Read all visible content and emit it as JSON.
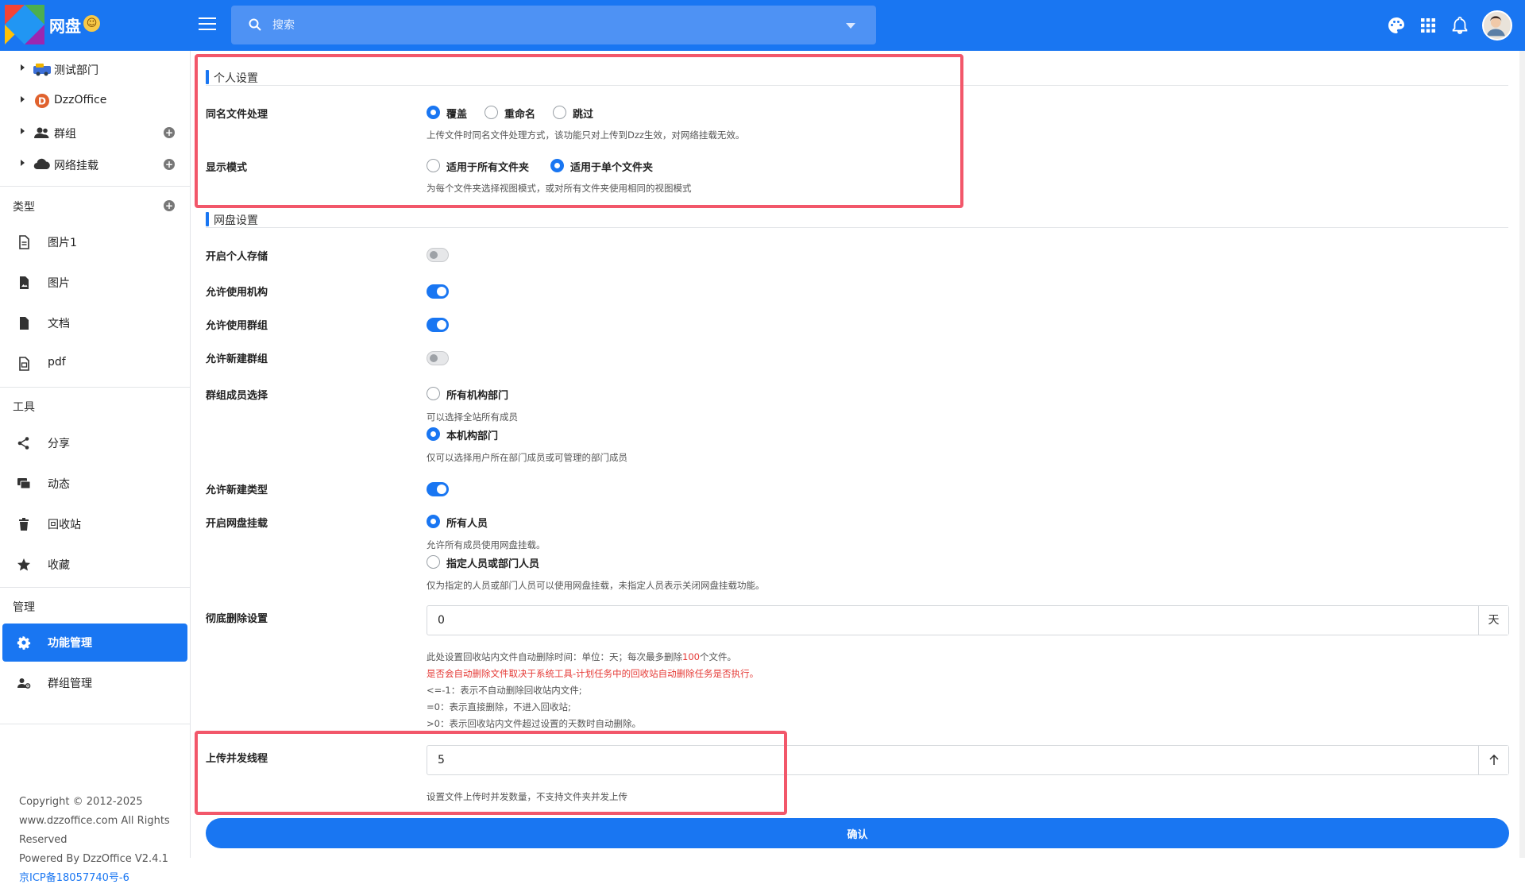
{
  "topbar": {
    "app_title": "网盘",
    "app_emoji": "😊",
    "search_placeholder": "搜索",
    "icons": [
      "palette-icon",
      "apps-grid-icon",
      "bell-icon"
    ],
    "brand_color": "#1976f2"
  },
  "sidebar": {
    "tree": [
      {
        "label": "测试部门",
        "icon": "department-icon",
        "has_add": false
      },
      {
        "label": "DzzOffice",
        "icon": "org-d-icon",
        "has_add": false
      },
      {
        "label": "群组",
        "icon": "group-icon",
        "has_add": true
      },
      {
        "label": "网络挂载",
        "icon": "cloud-icon",
        "has_add": true
      }
    ],
    "types_title": "类型",
    "types": [
      {
        "label": "图片1",
        "icon": "file-icon"
      },
      {
        "label": "图片",
        "icon": "image-file-icon"
      },
      {
        "label": "文档",
        "icon": "document-icon"
      },
      {
        "label": "pdf",
        "icon": "pdf-file-icon"
      }
    ],
    "tools_title": "工具",
    "tools": [
      {
        "label": "分享",
        "icon": "share-icon"
      },
      {
        "label": "动态",
        "icon": "activity-icon"
      },
      {
        "label": "回收站",
        "icon": "trash-icon"
      },
      {
        "label": "收藏",
        "icon": "star-icon"
      }
    ],
    "admin_title": "管理",
    "admin": [
      {
        "label": "功能管理",
        "icon": "gear-icon",
        "active": true
      },
      {
        "label": "群组管理",
        "icon": "group-manage-icon",
        "active": false
      }
    ],
    "footer": {
      "copyright": "Copyright © 2012-2025",
      "site": "www.dzzoffice.com All Rights",
      "reserved": "Reserved",
      "powered": "Powered By DzzOffice V2.4.1",
      "icp": "京ICP备18057740号-6"
    }
  },
  "personal": {
    "title": "个人设置",
    "same_name": {
      "label": "同名文件处理",
      "options": [
        "覆盖",
        "重命名",
        "跳过"
      ],
      "selected": 0,
      "hint": "上传文件时同名文件处理方式，该功能只对上传到Dzz生效，对网络挂载无效。"
    },
    "display_mode": {
      "label": "显示模式",
      "options": [
        "适用于所有文件夹",
        "适用于单个文件夹"
      ],
      "selected": 1,
      "hint": "为每个文件夹选择视图模式，或对所有文件夹使用相同的视图模式"
    }
  },
  "netdisk": {
    "title": "网盘设置",
    "personal_storage": {
      "label": "开启个人存储",
      "on": false
    },
    "allow_org": {
      "label": "允许使用机构",
      "on": true
    },
    "allow_group": {
      "label": "允许使用群组",
      "on": true
    },
    "allow_new_group": {
      "label": "允许新建群组",
      "on": false
    },
    "group_member": {
      "label": "群组成员选择",
      "opt1": "所有机构部门",
      "hint1": "可以选择全站所有成员",
      "opt2": "本机构部门",
      "hint2": "仅可以选择用户所在部门成员或可管理的部门成员",
      "selected": 1
    },
    "allow_new_type": {
      "label": "允许新建类型",
      "on": true
    },
    "mount": {
      "label": "开启网盘挂载",
      "opt1": "所有人员",
      "hint1": "允许所有成员使用网盘挂载。",
      "opt2": "指定人员或部门人员",
      "hint2": "仅为指定的人员或部门人员可以使用网盘挂载，未指定人员表示关闭网盘挂载功能。",
      "selected": 0
    },
    "purge": {
      "label": "彻底删除设置",
      "value": "0",
      "unit": "天",
      "hint_pre": "此处设置回收站内文件自动删除时间：单位：天；每次最多删除",
      "hint_num": "100",
      "hint_post": "个文件。",
      "hint_red": "是否会自动删除文件取决于系统工具-计划任务中的回收站自动删除任务是否执行。",
      "rule1": "<=-1：表示不自动删除回收站内文件;",
      "rule2": "=0：表示直接删除，不进入回收站;",
      "rule3": ">0：表示回收站内文件超过设置的天数时自动删除。"
    },
    "upload_threads": {
      "label": "上传并发线程",
      "value": "5",
      "hint": "设置文件上传时并发数量，不支持文件夹并发上传"
    }
  },
  "confirm_label": "确认",
  "highlight_color": "#f2576a"
}
